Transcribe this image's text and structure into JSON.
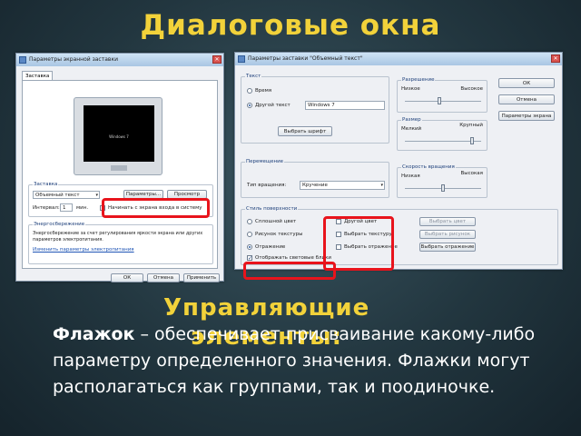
{
  "slide": {
    "title": "Диалоговые окна",
    "subtitle_line1": "Управляющие",
    "subtitle_line2": "элементы:",
    "term": "Флажок",
    "definition": " – обеспечивает присваивание какому-либо параметру определенного значения. Флажки могут располагаться как группами, так и поодиночке."
  },
  "left_window": {
    "title": "Параметры экранной заставки",
    "tab": "Заставка",
    "preview_text": "Windows 7",
    "group_screensaver": "Заставка",
    "screensaver_value": "Объемный текст",
    "params_button": "Параметры...",
    "preview_button": "Просмотр",
    "interval_label": "Интервал:",
    "interval_value": "1",
    "minutes_label": "мин.",
    "resume_checkbox": "Начинать с экрана входа в систему",
    "group_power": "Энергосбережение",
    "power_text": "Энергосбережение за счет регулирования яркости экрана или других параметров электропитания.",
    "power_link": "Изменить параметры электропитания",
    "ok": "ОК",
    "cancel": "Отмена",
    "apply": "Применить"
  },
  "right_window": {
    "title": "Параметры заставки \"Объемный текст\"",
    "group_text": "Текст",
    "radio_time": "Время",
    "radio_custom": "Другой текст",
    "custom_text_value": "Windows 7",
    "font_button": "Выбрать шрифт",
    "group_resolution": "Разрешение",
    "res_low": "Низкое",
    "res_high": "Высокое",
    "group_size": "Размер",
    "size_small": "Мелкий",
    "size_large": "Крупный",
    "ok": "ОК",
    "cancel": "Отмена",
    "screen_params": "Параметры экрана",
    "group_motion": "Перемещение",
    "rotation_type_label": "Тип вращения:",
    "rotation_type_value": "Кручение",
    "group_speed": "Скорость вращения",
    "speed_low": "Низкая",
    "speed_high": "Высокая",
    "group_surface": "Стиль поверхности",
    "radio_solid": "Сплошной цвет",
    "radio_texture": "Рисунок текстуры",
    "radio_reflection": "Отражение",
    "chk_custom_color": "Другой цвет",
    "chk_choose_texture": "Выбрать текстуру",
    "chk_choose_reflection": "Выбрать отражение",
    "btn_choose_color": "Выбрать цвет",
    "btn_choose_picture": "Выбрать рисунок",
    "btn_choose_reflection": "Выбрать отражение",
    "chk_show_highlights": "Отображать световые блики"
  },
  "colors": {
    "title": "#f2d23a",
    "highlight": "#e8141c",
    "body_text": "#ffffff"
  }
}
